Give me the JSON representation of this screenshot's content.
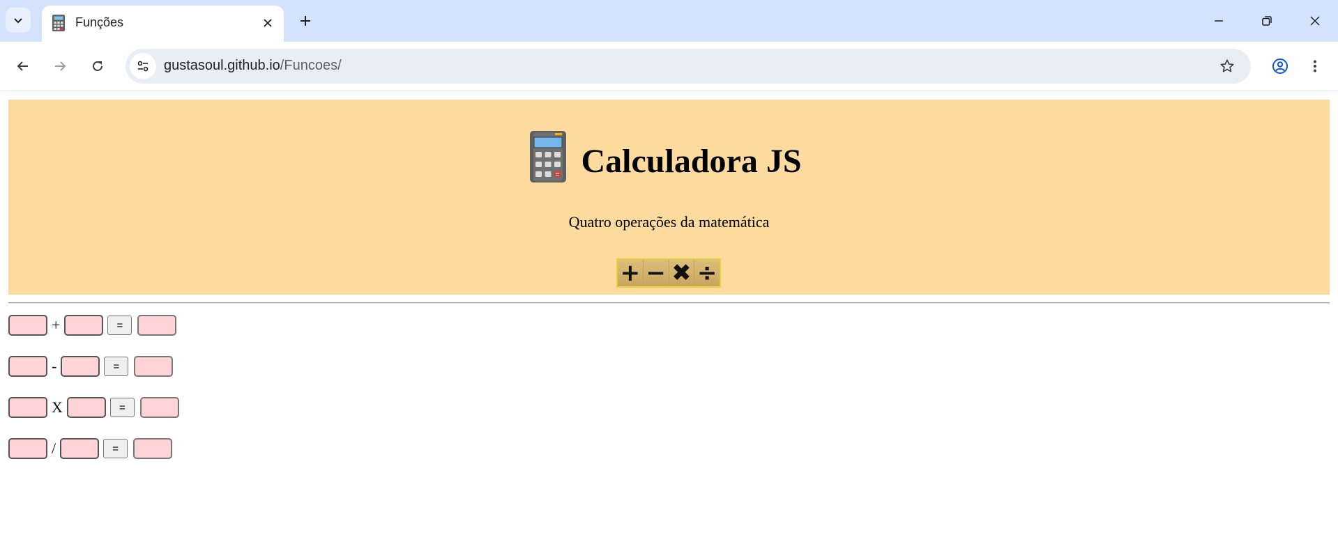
{
  "browser": {
    "tab_title": "Funções",
    "url_domain": "gustasoul.github.io",
    "url_path": "/Funcoes/"
  },
  "page": {
    "title": "Calculadora JS",
    "subtitle": "Quatro operações da matemática",
    "ops_symbols": [
      "+",
      "−",
      "✖",
      "÷"
    ],
    "equals_label": "=",
    "rows": [
      {
        "operator": "+",
        "a": "",
        "b": "",
        "result": ""
      },
      {
        "operator": "-",
        "a": "",
        "b": "",
        "result": ""
      },
      {
        "operator": "X",
        "a": "",
        "b": "",
        "result": ""
      },
      {
        "operator": "/",
        "a": "",
        "b": "",
        "result": ""
      }
    ]
  },
  "colors": {
    "header_bg": "#fddb9e",
    "input_bg": "#ffd4d6",
    "tabstrip_bg": "#d3e3fd",
    "omnibox_bg": "#e9eef6"
  }
}
